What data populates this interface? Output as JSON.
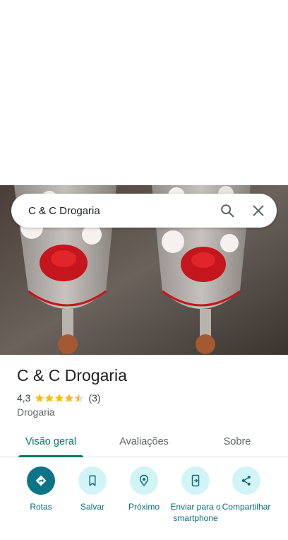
{
  "search": {
    "query": "C & C Drogaria"
  },
  "place": {
    "title": "C & C Drogaria",
    "rating": "4,3",
    "rating_value": 4.3,
    "review_count": "(3)",
    "category": "Drogaria"
  },
  "tabs": [
    {
      "label": "Visão geral",
      "active": true
    },
    {
      "label": "Avaliações",
      "active": false
    },
    {
      "label": "Sobre",
      "active": false
    }
  ],
  "actions": [
    {
      "label": "Rotas",
      "icon": "directions-icon"
    },
    {
      "label": "Salvar",
      "icon": "bookmark-icon"
    },
    {
      "label": "Próximo",
      "icon": "nearby-icon"
    },
    {
      "label": "Enviar para o smartphone",
      "icon": "send-to-phone-icon"
    },
    {
      "label": "Compartilhar",
      "icon": "share-icon"
    }
  ],
  "colors": {
    "accent": "#00796b",
    "action_primary": "#0c7585",
    "action_bg": "#d2f4f7",
    "star": "#fbbc04"
  }
}
